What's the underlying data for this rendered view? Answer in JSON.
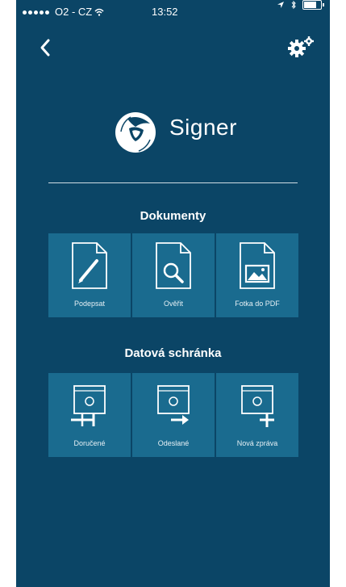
{
  "status_bar": {
    "carrier": "O2 - CZ",
    "time": "13:52",
    "battery_level": 0.85
  },
  "nav": {
    "back_icon": "chevron-left-icon",
    "settings_icon": "gears-icon"
  },
  "brand": {
    "name": "Signer"
  },
  "sections": [
    {
      "title": "Dokumenty",
      "tiles": [
        {
          "label": "Podepsat",
          "icon": "document-sign-icon"
        },
        {
          "label": "Ověřit",
          "icon": "document-verify-icon"
        },
        {
          "label": "Fotka do PDF",
          "icon": "photo-to-pdf-icon"
        }
      ]
    },
    {
      "title": "Datová schránka",
      "tiles": [
        {
          "label": "Doručené",
          "icon": "inbox-received-icon"
        },
        {
          "label": "Odeslané",
          "icon": "outbox-sent-icon"
        },
        {
          "label": "Nová zpráva",
          "icon": "new-message-icon"
        }
      ]
    }
  ],
  "colors": {
    "background": "#0b4566",
    "tile": "#1a6b8f",
    "text": "#ffffff"
  }
}
